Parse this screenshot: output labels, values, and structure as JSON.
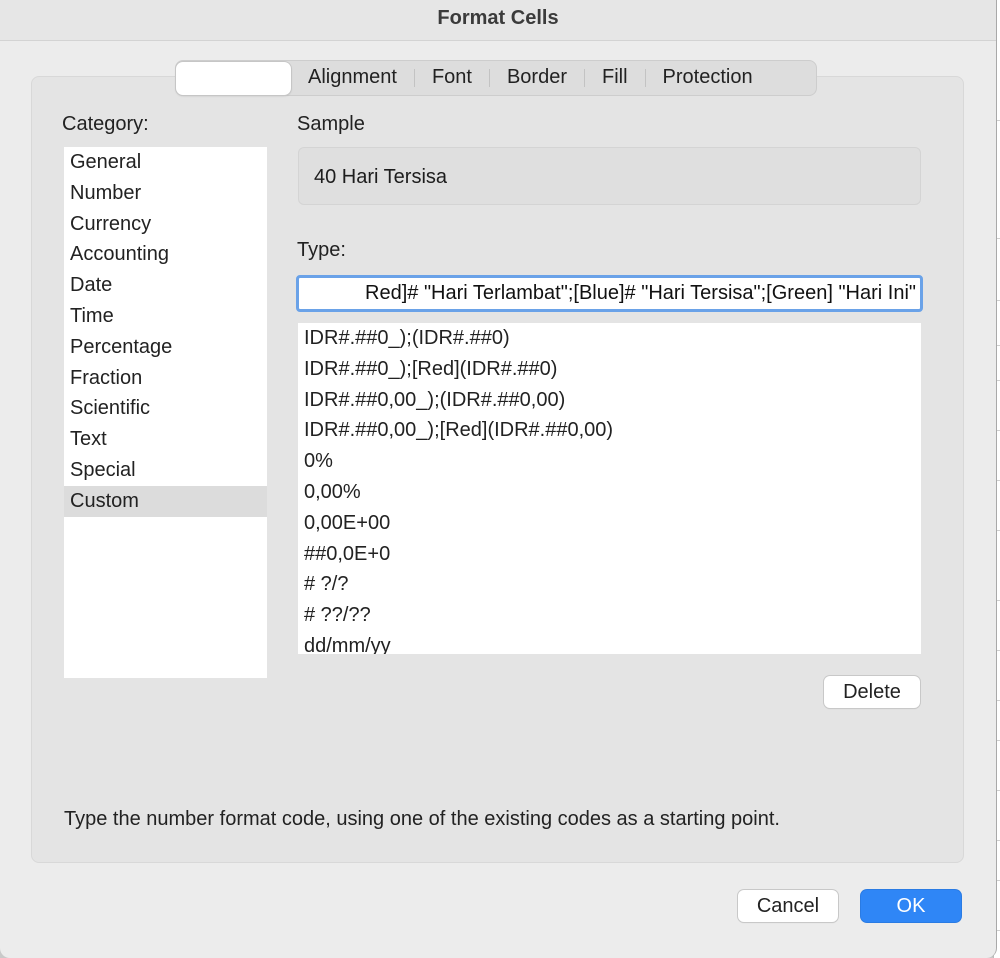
{
  "window": {
    "title": "Format Cells"
  },
  "tabs": [
    {
      "label": ""
    },
    {
      "label": "Alignment"
    },
    {
      "label": "Font"
    },
    {
      "label": "Border"
    },
    {
      "label": "Fill"
    },
    {
      "label": "Protection"
    }
  ],
  "category": {
    "label": "Category:",
    "items": [
      "General",
      "Number",
      "Currency",
      "Accounting",
      "Date",
      "Time",
      "Percentage",
      "Fraction",
      "Scientific",
      "Text",
      "Special",
      "Custom"
    ],
    "selected": "Custom"
  },
  "sample": {
    "label": "Sample",
    "value": "40 Hari Tersisa"
  },
  "type": {
    "label": "Type:",
    "value": "Red]# \"Hari Terlambat\";[Blue]# \"Hari Tersisa\";[Green] \"Hari Ini\""
  },
  "formats": [
    "IDR#.##0_);(IDR#.##0)",
    "IDR#.##0_);[Red](IDR#.##0)",
    "IDR#.##0,00_);(IDR#.##0,00)",
    "IDR#.##0,00_);[Red](IDR#.##0,00)",
    "0%",
    "0,00%",
    "0,00E+00",
    "##0,0E+0",
    "# ?/?",
    "# ??/??",
    "dd/mm/yy"
  ],
  "buttons": {
    "delete": "Delete",
    "cancel": "Cancel",
    "ok": "OK"
  },
  "hint": "Type the number format code, using one of the existing codes as a starting point.",
  "colors": {
    "accent": "#2f86f6",
    "focus_ring": "#6aa2e8"
  }
}
